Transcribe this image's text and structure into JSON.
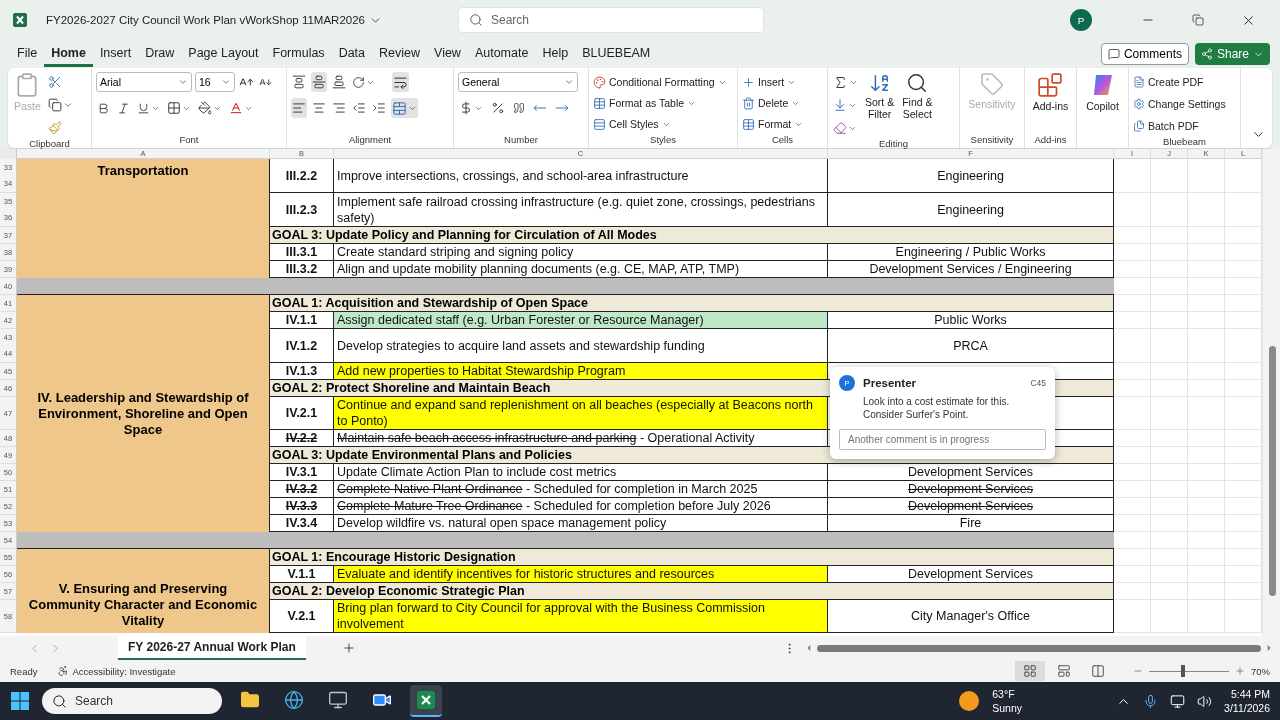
{
  "window": {
    "title": "FY2026-2027 City Council Work Plan vWorkShop 11MAR2026",
    "search_placeholder": "Search",
    "avatar": "P"
  },
  "menu": {
    "tabs": [
      {
        "label": "File",
        "selected": false
      },
      {
        "label": "Home",
        "selected": true
      },
      {
        "label": "Insert",
        "selected": false
      },
      {
        "label": "Draw",
        "selected": false
      },
      {
        "label": "Page Layout",
        "selected": false
      },
      {
        "label": "Formulas",
        "selected": false
      },
      {
        "label": "Data",
        "selected": false
      },
      {
        "label": "Review",
        "selected": false
      },
      {
        "label": "View",
        "selected": false
      },
      {
        "label": "Automate",
        "selected": false
      },
      {
        "label": "Help",
        "selected": false
      },
      {
        "label": "BLUEBEAM",
        "selected": false
      }
    ],
    "comments": "Comments",
    "share": "Share"
  },
  "ribbon": {
    "clipboard": {
      "label": "Clipboard",
      "paste": "Paste"
    },
    "font": {
      "label": "Font",
      "font_name": "Arial",
      "font_size": "16"
    },
    "alignment": {
      "label": "Alignment"
    },
    "number": {
      "label": "Number",
      "format": "General"
    },
    "styles": {
      "label": "Styles",
      "items": [
        "Conditional Formatting",
        "Format as Table",
        "Cell Styles"
      ]
    },
    "cells": {
      "label": "Cells",
      "items": [
        "Insert",
        "Delete",
        "Format"
      ]
    },
    "editing": {
      "label": "Editing",
      "sort": [
        "Sort &",
        "Filter"
      ],
      "find": [
        "Find &",
        "Select"
      ]
    },
    "sensitivity": {
      "label": "Sensitivity",
      "button": "Sensitivity",
      "disabled": true
    },
    "addins": {
      "label": "Add-ins",
      "button": "Add-ins"
    },
    "copilot": {
      "button": "Copilot"
    },
    "bluebeam": {
      "label": "Bluebeam",
      "items": [
        "Create PDF",
        "Change Settings",
        "Batch PDF"
      ]
    }
  },
  "sheet": {
    "column_headers": [
      "A",
      "B",
      "C",
      "F",
      "I",
      "J",
      "K",
      "L"
    ],
    "blocks": [
      {
        "kind": "section",
        "area": "Transportation",
        "lines": [
          {
            "kind": "item",
            "rows": [
              "33",
              "34"
            ],
            "id": "III.2.2",
            "task": "Improve intersections, crossings, and school-area infrastructure",
            "dept": "Engineering",
            "struck": false
          },
          {
            "kind": "item",
            "rows": [
              "35",
              "36"
            ],
            "id": "III.2.3",
            "task": "Implement safe railroad crossing infrastructure (e.g. quiet zone, crossings, pedestrians safety)",
            "dept": "Engineering",
            "struck": false
          },
          {
            "kind": "goal",
            "rows": [
              "37"
            ],
            "label": "GOAL 3: Update Policy and Planning for Circulation of All Modes"
          },
          {
            "kind": "item",
            "rows": [
              "38"
            ],
            "id": "III.3.1",
            "task": "Create standard striping and signing policy",
            "dept": "Engineering / Public Works",
            "struck": false
          },
          {
            "kind": "item",
            "rows": [
              "39"
            ],
            "id": "III.3.2",
            "task": "Align and update mobility planning documents (e.g. CE, MAP, ATP, TMP)",
            "dept": "Development Services / Engineering",
            "struck": false
          }
        ]
      },
      {
        "kind": "separator",
        "rows": [
          "40"
        ]
      },
      {
        "kind": "section",
        "area": "IV. Leadership and Stewardship of Environment, Shoreline and Open Space",
        "lines": [
          {
            "kind": "goal",
            "rows": [
              "41"
            ],
            "label": "GOAL 1: Acquisition and Stewardship of Open Space"
          },
          {
            "kind": "item",
            "rows": [
              "42"
            ],
            "id": "IV.1.1",
            "task": "Assign dedicated staff (e.g. Urban Forester or Resource Manager)",
            "color": "#bfe8c8",
            "dept": "Public Works",
            "struck": false
          },
          {
            "kind": "item",
            "rows": [
              "43",
              "44"
            ],
            "id": "IV.1.2",
            "task": "Develop strategies to acquire land assets and stewardship funding",
            "dept": "PRCA",
            "struck": false
          },
          {
            "kind": "item",
            "rows": [
              "45"
            ],
            "id": "IV.1.3",
            "task": "Add new properties to Habitat Stewardship Program",
            "color": "#ffff00",
            "struck": false
          },
          {
            "kind": "goal",
            "rows": [
              "46"
            ],
            "label": "GOAL 2: Protect Shoreline and Maintain Beach"
          },
          {
            "kind": "item",
            "rows": [
              "47"
            ],
            "id": "IV.2.1",
            "task": "Continue and expand sand replenishment on all beaches (especially at Beacons north to Ponto)",
            "color": "#ffff00",
            "struck": false
          },
          {
            "kind": "item",
            "rows": [
              "48"
            ],
            "id": "IV.2.2",
            "task_struck": "Maintain safe beach access infrastructure and parking",
            "task": " - Operational Activity",
            "struck": true
          },
          {
            "kind": "goal",
            "rows": [
              "49"
            ],
            "label": "GOAL 3: Update Environmental Plans and Policies"
          },
          {
            "kind": "item",
            "rows": [
              "50"
            ],
            "id": "IV.3.1",
            "task": "Update Climate Action Plan to include cost metrics",
            "dept": "Development Services",
            "struck": false
          },
          {
            "kind": "item",
            "rows": [
              "51"
            ],
            "id": "IV.3.2",
            "task_struck": "Complete Native Plant Ordinance",
            "task": " - Scheduled for completion in March 2025",
            "dept": "Development Services",
            "struck": true
          },
          {
            "kind": "item",
            "rows": [
              "52"
            ],
            "id": "IV.3.3",
            "task_struck": "Complete Mature Tree Ordinance",
            "task": " - Scheduled for completion before July 2026",
            "dept": "Development Services",
            "struck": true
          },
          {
            "kind": "item",
            "rows": [
              "53"
            ],
            "id": "IV.3.4",
            "task": "Develop wildfire vs. natural open space management policy",
            "dept": "Fire",
            "struck": false
          }
        ]
      },
      {
        "kind": "separator",
        "rows": [
          "54"
        ]
      },
      {
        "kind": "section",
        "area": "V. Ensuring and Preserving Community Character and Economic Vitality",
        "lines": [
          {
            "kind": "goal",
            "rows": [
              "55"
            ],
            "label": "GOAL 1: Encourage Historic Designation"
          },
          {
            "kind": "item",
            "rows": [
              "56"
            ],
            "id": "V.1.1",
            "task": "Evaluate and identify incentives for historic structures and resources",
            "color": "#ffff00",
            "dept": "Development Services",
            "struck": false
          },
          {
            "kind": "goal",
            "rows": [
              "57"
            ],
            "label": "GOAL 2: Develop Economic Strategic Plan"
          },
          {
            "kind": "item",
            "rows": [
              "58"
            ],
            "id": "V.2.1",
            "task": "Bring plan forward to City Council for approval with the Business Commission involvement",
            "color": "#ffff00",
            "dept": "City Manager's Office",
            "struck": false
          }
        ]
      }
    ]
  },
  "comment": {
    "avatar": "P",
    "author": "Presenter",
    "cell": "C45",
    "text": "Look into a cost estimate for this. Consider Surfer's Point.",
    "reply_placeholder": "Another comment is in progress"
  },
  "sheet_tabs": [
    {
      "label": "FY 2026-27 Annual Work Plan",
      "selected": true
    }
  ],
  "status_bar": {
    "ready": "Ready",
    "accessibility": "Accessibility: Investigate",
    "views": [
      {
        "kind": "normal",
        "selected": true
      },
      {
        "kind": "page_layout",
        "selected": false
      },
      {
        "kind": "page_break",
        "selected": false
      }
    ],
    "zoom": {
      "level": 0.42,
      "reading": "70%"
    }
  },
  "taskbar": {
    "search_placeholder": "Search",
    "apps": [
      {
        "kind": "files",
        "selected": false
      },
      {
        "kind": "browser",
        "selected": false
      },
      {
        "kind": "remote",
        "selected": false
      },
      {
        "kind": "video",
        "selected": false
      },
      {
        "kind": "sheets",
        "selected": true
      }
    ],
    "temperature": "63°F",
    "weather": "Sunny",
    "time": "5:44 PM",
    "date": "3/11/2026"
  }
}
